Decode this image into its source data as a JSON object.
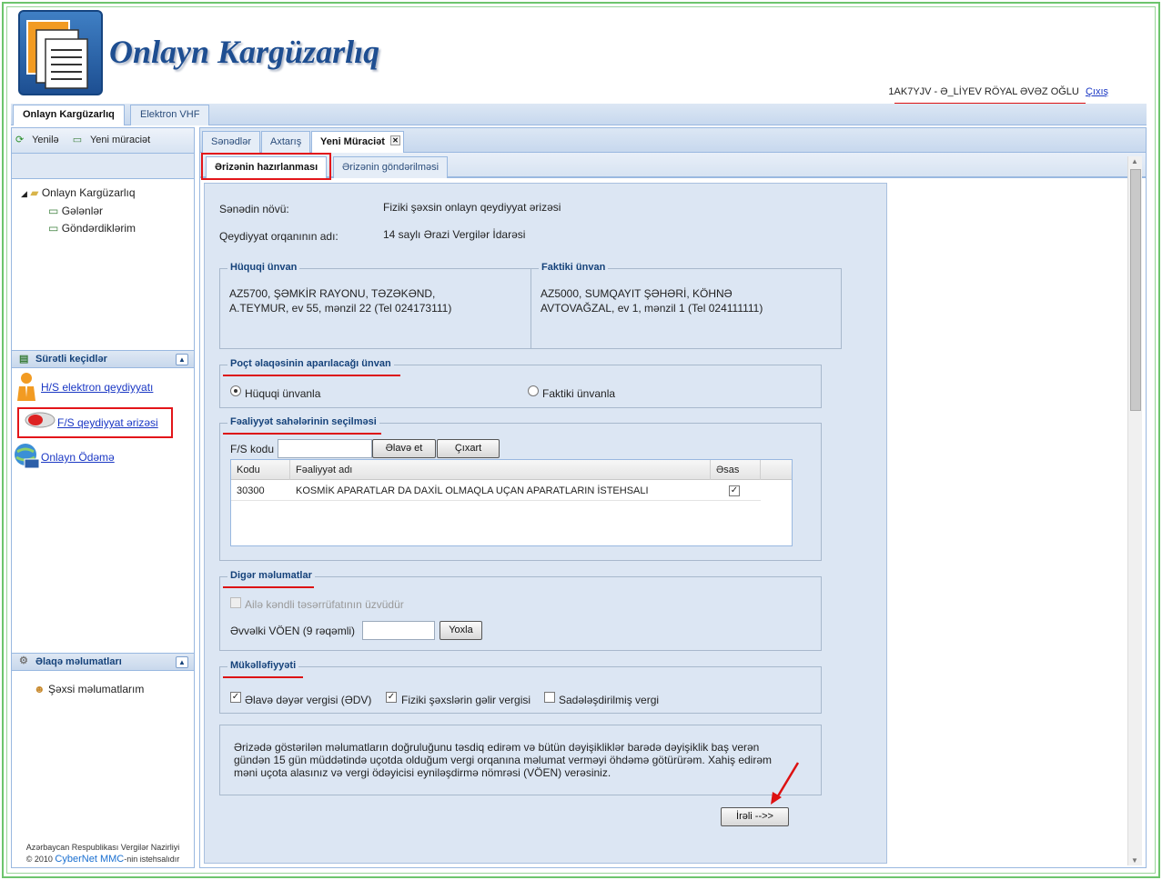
{
  "app": {
    "title": "Onlayn Kargüzarlıq"
  },
  "user": {
    "name": "1AK7YJV - Ə_LİYEV RÖYAL ƏVƏZ OĞLU",
    "logout": "Çıxış"
  },
  "top_tabs": [
    {
      "label": "Onlayn Kargüzarlıq"
    },
    {
      "label": "Elektron VHF"
    }
  ],
  "left": {
    "toolbar": {
      "refresh": "Yenilə",
      "new_request": "Yeni müraciət"
    },
    "tree": {
      "root": "Onlayn Kargüzarlıq",
      "items": [
        "Gələnlər",
        "Göndərdiklərim"
      ]
    },
    "quick_links": {
      "title": "Sürətli keçidlər",
      "items": [
        "H/S elektron qeydiyyatı",
        "F/S qeydiyyat ərizəsi",
        "Onlayn Ödəmə"
      ]
    },
    "contact": {
      "title": "Əlaqə məlumatları",
      "item": "Şəxsi məlumatlarım"
    },
    "footer": {
      "line1": "Azərbaycan Respublikası Vergilər Nazirliyi",
      "copyright": "© 2010",
      "company": "CyberNet MMC",
      "suffix": "-nin istehsalıdır"
    }
  },
  "main_tabs": [
    "Sənədlər",
    "Axtarış",
    "Yeni Müraciət"
  ],
  "sub_tabs": [
    "Ərizənin hazırlanması",
    "Ərizənin göndərilməsi"
  ],
  "form": {
    "doc_type_label": "Sənədin növü:",
    "doc_type_value": "Fiziki şəxsin onlayn qeydiyyat ərizəsi",
    "org_label": "Qeydiyyat orqanının adı:",
    "org_value": "14 saylı Ərazi Vergilər İdarəsi",
    "legal_address": {
      "title": "Hüquqi ünvan",
      "line1": "AZ5700, ŞƏMKİR RAYONU, TƏZƏKƏND,",
      "line2": "A.TEYMUR, ev 55, mənzil 22 (Tel 024173111)"
    },
    "actual_address": {
      "title": "Faktiki ünvan",
      "line1": "AZ5000, SUMQAYIT ŞƏHƏRİ, KÖHNƏ",
      "line2": "AVTOVAĞZAL, ev 1, mənzil 1 (Tel 024111111)"
    },
    "postal": {
      "title": "Poçt əlaqəsinin aparılacağı ünvan",
      "option_legal": "Hüquqi ünvanla",
      "option_actual": "Faktiki ünvanla",
      "selected": "legal"
    },
    "activity": {
      "title": "Fəaliyyət sahələrinin seçilməsi",
      "fs_label": "F/S kodu",
      "fs_value": "",
      "add": "Əlavə et",
      "remove": "Çıxart",
      "columns": [
        "Kodu",
        "Fəaliyyət adı",
        "Əsas"
      ],
      "rows": [
        {
          "code": "30300",
          "name": "KOSMİK APARATLAR DA DAXİL OLMAQLA UÇAN APARATLARIN İSTEHSALI",
          "main": true
        }
      ]
    },
    "other": {
      "title": "Digər məlumatlar",
      "family_farm": "Ailə kəndli təsərrüfatının üzvüdür",
      "prev_voen_label": "Əvvəlki VÖEN (9 rəqəmli)",
      "prev_voen_value": "",
      "check": "Yoxla"
    },
    "obligations": {
      "title": "Mükəlləfiyyəti",
      "vat": "Əlavə dəyər vergisi (ƏDV)",
      "income": "Fiziki şəxslərin gəlir vergisi",
      "simplified": "Sadələşdirilmiş vergi"
    },
    "declaration": {
      "line1": "Ərizədə göstərilən məlumatların doğruluğunu təsdiq edirəm və bütün dəyişikliklər barədə dəyişiklik baş verən",
      "line2": "gündən 15 gün müddətində uçotda olduğum vergi orqanına məlumat verməyi öhdəmə götürürəm. Xahiş edirəm",
      "line3": "məni uçota alasınız və vergi ödəyicisi eyniləşdirmə nömrəsi (VÖEN) verəsiniz."
    },
    "next": "İrəli -->>"
  },
  "colors": {
    "accent": "#1e4e91",
    "highlight": "#e3151a"
  }
}
